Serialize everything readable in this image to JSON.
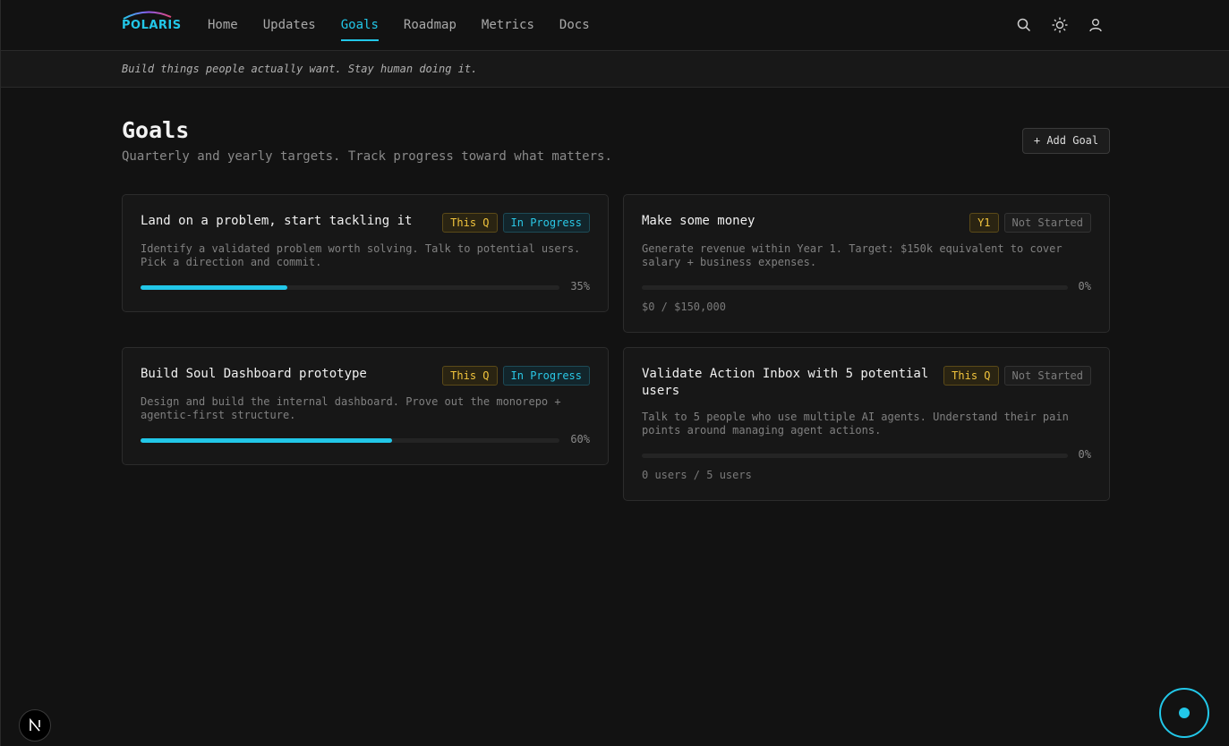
{
  "brand": {
    "name": "POLARIS",
    "accent": "#22c7e8"
  },
  "nav": {
    "links": [
      {
        "label": "Home"
      },
      {
        "label": "Updates"
      },
      {
        "label": "Goals",
        "active": true
      },
      {
        "label": "Roadmap"
      },
      {
        "label": "Metrics"
      },
      {
        "label": "Docs"
      }
    ],
    "icons": [
      "search-icon",
      "sun-icon",
      "user-icon"
    ]
  },
  "tagline": "Build things people actually want. Stay human doing it.",
  "header": {
    "title": "Goals",
    "subtitle": "Quarterly and yearly targets. Track progress toward what matters.",
    "add_button": "+ Add Goal"
  },
  "goals": [
    {
      "title": "Land on a problem, start tackling it",
      "badge_period": "This Q",
      "badge_status": "In Progress",
      "description_line1": "Identify a validated problem worth solving. Talk to potential users.",
      "description_line2": "Pick a direction and commit.",
      "progress": 0.35,
      "progress_label": "35%"
    },
    {
      "title": "Make some money",
      "badge_period": "Y1",
      "badge_status": "Not Started",
      "description_line1": "Generate revenue within Year 1. Target: $150k equivalent to cover",
      "description_line2": "salary + business expenses.",
      "progress": 0,
      "progress_label": "0%",
      "metric": "$0 / $150,000"
    },
    {
      "title": "Build Soul Dashboard prototype",
      "badge_period": "This Q",
      "badge_status": "In Progress",
      "description_line1": "Design and build the internal dashboard. Prove out the monorepo +",
      "description_line2": "agentic-first structure.",
      "progress": 0.6,
      "progress_label": "60%"
    },
    {
      "title_line1": "Validate Action Inbox with 5 potential",
      "title_line2": "users",
      "badge_period": "This Q",
      "badge_status": "Not Started",
      "description_line1": "Talk to 5 people who use multiple AI agents. Understand their pain",
      "description_line2": "points around managing agent actions.",
      "progress": 0,
      "progress_label": "0%",
      "metric": "0 users / 5 users"
    }
  ],
  "floating": {
    "left_button_letter": "N"
  }
}
